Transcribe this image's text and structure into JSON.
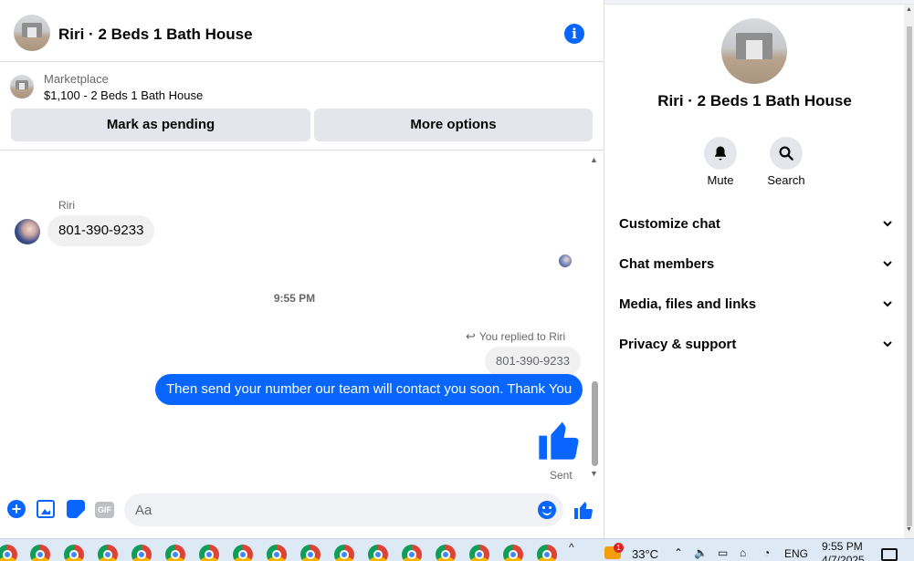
{
  "header": {
    "title": "Riri · 2 Beds 1 Bath House"
  },
  "marketplace": {
    "label": "Marketplace",
    "listing": "$1,100 - 2 Beds 1 Bath House",
    "mark_pending": "Mark as pending",
    "more_options": "More options"
  },
  "messages": {
    "sender_name": "Riri",
    "incoming_text": "801-390-9233",
    "timestamp": "9:55 PM",
    "replied_label": "You replied to Riri",
    "quoted_text": "801-390-9233",
    "outgoing_text": "Then send your number our team will contact you soon. Thank You",
    "status": "Sent"
  },
  "composer": {
    "placeholder": "Aa",
    "gif_label": "GIF"
  },
  "info_panel": {
    "name": "Riri · 2 Beds 1 Bath House",
    "mute_label": "Mute",
    "search_label": "Search",
    "rows": [
      {
        "label": "Customize chat"
      },
      {
        "label": "Chat members"
      },
      {
        "label": "Media, files and links"
      },
      {
        "label": "Privacy & support"
      }
    ]
  },
  "taskbar": {
    "weather_badge": "1",
    "temperature": "33°C",
    "language": "ENG",
    "time": "9:55 PM",
    "date": "4/7/2025"
  },
  "colors": {
    "accent": "#0866ff",
    "bubble_in": "#f0f0f0",
    "button_bg": "#e4e6eb"
  }
}
